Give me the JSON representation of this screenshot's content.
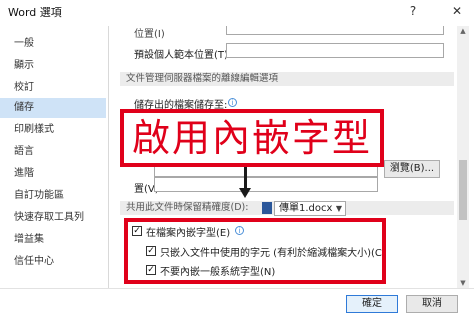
{
  "window": {
    "title": "Word 選項",
    "help_icon": "?",
    "close_icon": "✕"
  },
  "sidebar": {
    "items": [
      {
        "label": "一般"
      },
      {
        "label": "顯示"
      },
      {
        "label": "校訂"
      },
      {
        "label": "儲存"
      },
      {
        "label": "印刷樣式"
      },
      {
        "label": "語言"
      },
      {
        "label": "進階"
      },
      {
        "label": "自訂功能區"
      },
      {
        "label": "快速存取工具列"
      },
      {
        "label": "增益集"
      },
      {
        "label": "信任中心"
      }
    ],
    "selected_index": 3
  },
  "content": {
    "top_partial": "位置(I)",
    "default_template_label": "預設個人範本位置(T):",
    "section1_title": "文件管理伺服器檔案的離線編輯選項",
    "partial_label": "儲存出的檔案儲存至:",
    "browse_label": "瀏覽(B)...",
    "location_label": "置(V):",
    "section2_title": "共用此文件時保留精確度(D):",
    "document_name": "傳單1.docx",
    "embed_fonts_label": "在檔案內嵌字型(E)",
    "embed_subset_label": "只嵌入文件中使用的字元 (有利於縮減檔案大小)(C)",
    "no_common_fonts_label": "不要內嵌一般系統字型(N)",
    "checks": {
      "embed_fonts": true,
      "embed_subset": true,
      "no_common_fonts": true
    }
  },
  "callout": {
    "text": "啟用內嵌字型",
    "color": "#e0001a"
  },
  "buttons": {
    "ok": "確定",
    "cancel": "取消"
  },
  "icons": {
    "info": "information-icon",
    "doc": "word-document-icon",
    "arrow": "down-arrow-annotation"
  }
}
